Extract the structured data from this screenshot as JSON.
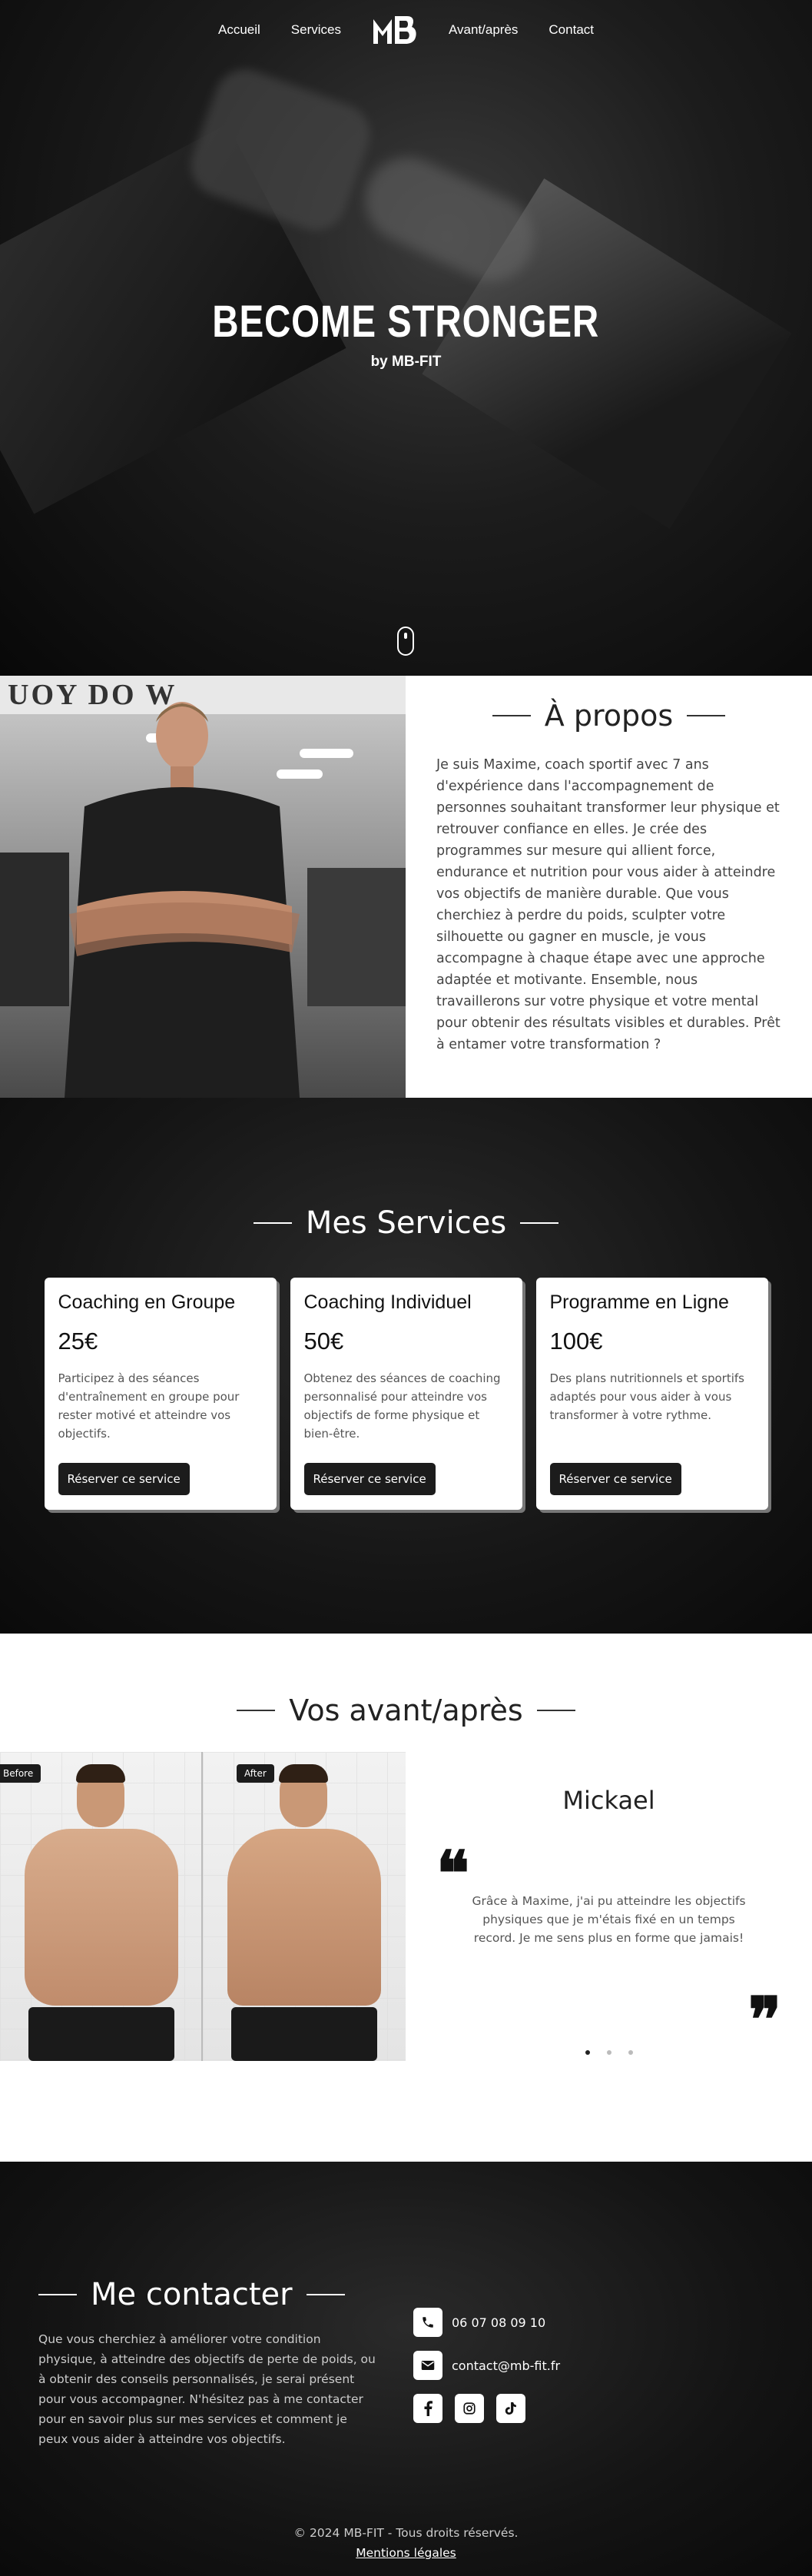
{
  "nav": {
    "items_left": [
      "Accueil",
      "Services"
    ],
    "items_right": [
      "Avant/après",
      "Contact"
    ],
    "logo_text": "MB"
  },
  "hero": {
    "title": "BECOME STRONGER",
    "subtitle": "by MB-FIT"
  },
  "about": {
    "banner_text": "UOY    DO W",
    "title": "À propos",
    "text": "Je suis Maxime, coach sportif avec 7 ans d'expérience dans l'accompagnement de personnes souhaitant transformer leur physique et retrouver confiance en elles. Je crée des programmes sur mesure qui allient force, endurance et nutrition pour vous aider à atteindre vos objectifs de manière durable. Que vous cherchiez à perdre du poids, sculpter votre silhouette ou gagner en muscle, je vous accompagne à chaque étape avec une approche adaptée et motivante. Ensemble, nous travaillerons sur votre physique et votre mental pour obtenir des résultats visibles et durables. Prêt à entamer votre transformation ?"
  },
  "services": {
    "title": "Mes Services",
    "cards": [
      {
        "name": "Coaching en Groupe",
        "price": "25€",
        "description": "Participez à des séances d'entraînement en groupe pour rester motivé et atteindre vos objectifs.",
        "button": "Réserver ce service"
      },
      {
        "name": "Coaching Individuel",
        "price": "50€",
        "description": "Obtenez des séances de coaching personnalisé pour atteindre vos objectifs de forme physique et bien-être.",
        "button": "Réserver ce service"
      },
      {
        "name": "Programme en Ligne",
        "price": "100€",
        "description": "Des plans nutritionnels et sportifs adaptés pour vous aider à vous transformer à votre rythme.",
        "button": "Réserver ce service"
      }
    ]
  },
  "before_after": {
    "title": "Vos avant/après",
    "before_label": "Before",
    "after_label": "After",
    "testimonial": {
      "name": "Mickael",
      "quote_open": "❝",
      "quote_close": "❞",
      "text": "Grâce à Maxime, j'ai pu atteindre les objectifs physiques que je m'étais fixé en un temps record. Je me sens plus en forme que jamais!"
    },
    "slides_count": 3,
    "active_slide": 1
  },
  "contact": {
    "title": "Me contacter",
    "text": "Que vous cherchiez à améliorer votre condition physique, à atteindre des objectifs de perte de poids, ou à obtenir des conseils personnalisés, je serai présent pour vous accompagner. N'hésitez pas à me contacter pour en savoir plus sur mes services et comment je peux vous aider à atteindre vos objectifs.",
    "phone": "06 07 08 09 10",
    "email": "contact@mb-fit.fr",
    "phone_icon": "phone-icon",
    "email_icon": "envelope-icon",
    "socials": [
      "facebook-icon",
      "instagram-icon",
      "tiktok-icon"
    ]
  },
  "footer": {
    "copyright": "© 2024 MB-FIT - Tous droits réservés.",
    "legal_link": "Mentions légales"
  }
}
